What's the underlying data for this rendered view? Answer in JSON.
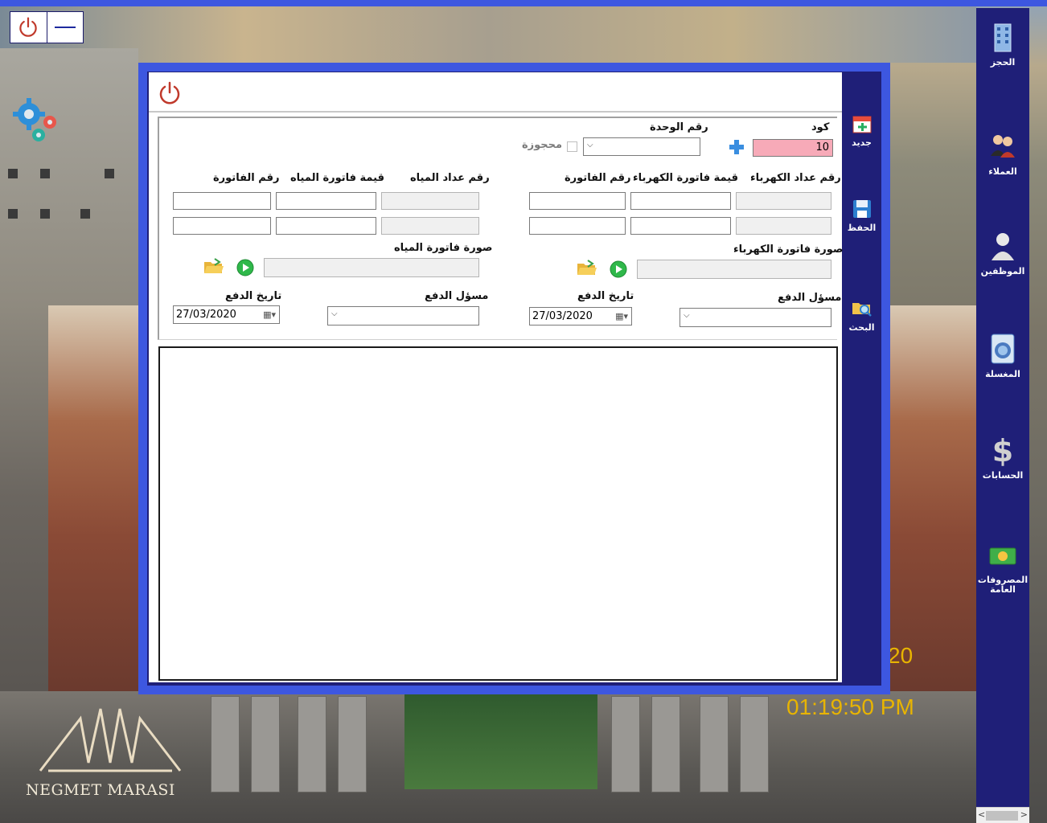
{
  "window": {
    "power_icon": "power-icon",
    "minimize_icon": "minimize-icon"
  },
  "brand": {
    "name": "NEGMET MARASI"
  },
  "clock": {
    "time": "01:19:50 PM",
    "fragment": "20"
  },
  "sidebar": {
    "items": [
      {
        "label": "الحجز",
        "icon": "building-icon"
      },
      {
        "label": "العملاء",
        "icon": "users-icon"
      },
      {
        "label": "الموظفين",
        "icon": "employee-icon"
      },
      {
        "label": "المغسلة",
        "icon": "washing-machine-icon"
      },
      {
        "label": "الحسابات",
        "icon": "dollar-icon"
      },
      {
        "label": "المصروفات العامة",
        "icon": "money-icon"
      }
    ]
  },
  "toolbar": {
    "new_label": "جديد",
    "save_label": "الحفظ",
    "search_label": "البحث"
  },
  "form": {
    "code_label": "كود",
    "code_value": "10",
    "unit_label": "رقم الوحدة",
    "reserved_label": "محجوزة",
    "electric": {
      "meter_label": "رقم عداد الكهرباء",
      "bill_value_label": "قيمة فاتورة الكهرباء",
      "bill_number_label": "رقم الفاتورة",
      "image_label": "صورة فاتورة الكهرباء",
      "payer_label": "مسؤل الدفع",
      "date_label": "تاريخ الدفع",
      "date_value": "27/03/2020"
    },
    "water": {
      "meter_label": "رقم عداد المياه",
      "bill_value_label": "قيمة فاتورة المياه",
      "bill_number_label": "رقم الفاتورة",
      "image_label": "صورة فاتورة المياه",
      "payer_label": "مسؤل الدفع",
      "date_label": "تاريخ الدفع",
      "date_value": "27/03/2020"
    }
  },
  "colors": {
    "accent_blue": "#3d57e0",
    "sidebar_navy": "#1f1f78",
    "code_field": "#f7aab8",
    "clock": "#e8b400"
  }
}
